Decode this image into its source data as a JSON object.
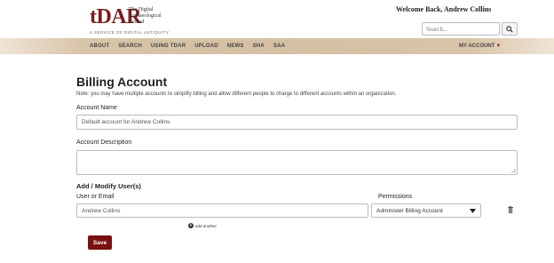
{
  "header": {
    "logo_mark": "tDAR",
    "logo_sub": "The Digital Archaeological Record",
    "logo_tag": "A SERVICE OF DIGITAL ANTIQUITY",
    "welcome": "Welcome Back, Andrew Collins",
    "search_placeholder": "Search...",
    "search_icon": "search-icon"
  },
  "nav": {
    "items": [
      "ABOUT",
      "SEARCH",
      "USING TDAR",
      "UPLOAD",
      "NEWS",
      "SHA",
      "SAA"
    ],
    "account": "MY ACCOUNT"
  },
  "page": {
    "title": "Billing Account",
    "note": "Note: you may have multiple accounts to simplify billing and allow different people to charge to different accounts within an organization."
  },
  "form": {
    "account_name_label": "Account Name",
    "account_name_value": "Default account for Andrew Collins",
    "account_description_label": "Account Description",
    "account_description_value": "",
    "users_section_label": "Add / Modify User(s)",
    "user_label": "User or Email",
    "user_value": "Andrew Collins",
    "permissions_label": "Permissions",
    "permissions_value": "Administer Billing Account",
    "add_another": "add another",
    "save": "Save"
  },
  "colors": {
    "brand": "#7a1c1c",
    "save_button": "#7a1010"
  }
}
